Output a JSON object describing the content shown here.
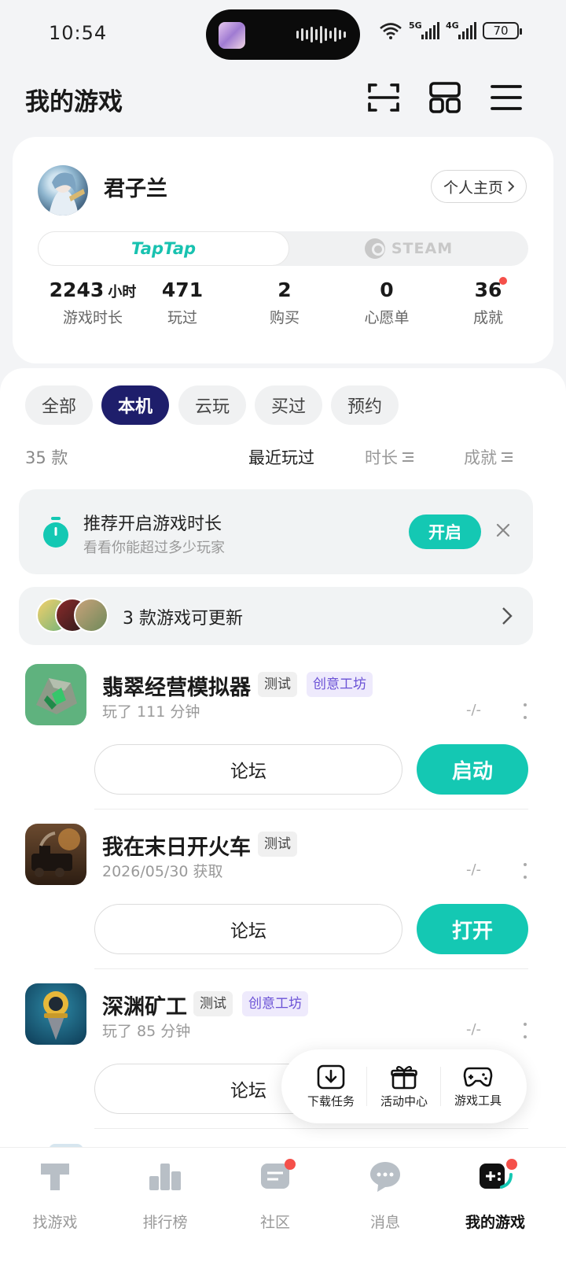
{
  "status_bar": {
    "time": "10:54",
    "net1": "5G",
    "net2": "4G",
    "battery": "70"
  },
  "header": {
    "title": "我的游戏"
  },
  "profile": {
    "username": "君子兰",
    "homepage_label": "个人主页",
    "platform_taptap": "TapTap",
    "platform_steam": "STEAM",
    "stats": [
      {
        "value": "2243",
        "unit": "小时",
        "label": "游戏时长"
      },
      {
        "value": "471",
        "unit": "",
        "label": "玩过"
      },
      {
        "value": "2",
        "unit": "",
        "label": "购买"
      },
      {
        "value": "0",
        "unit": "",
        "label": "心愿单"
      },
      {
        "value": "36",
        "unit": "",
        "label": "成就"
      }
    ]
  },
  "filters": [
    "全部",
    "本机",
    "云玩",
    "买过",
    "预约"
  ],
  "active_filter": "本机",
  "count_label": "35 款",
  "sort": [
    "最近玩过",
    "时长",
    "成就"
  ],
  "timer_banner": {
    "title": "推荐开启游戏时长",
    "subtitle": "看看你能超过多少玩家",
    "button": "开启"
  },
  "update_bar": {
    "text": "3 款游戏可更新"
  },
  "games": [
    {
      "title": "翡翠经营模拟器",
      "tags": [
        "测试",
        "创意工坊"
      ],
      "subtitle": "玩了 111 分钟",
      "ratio": "-/-",
      "forum": "论坛",
      "action": "启动"
    },
    {
      "title": "我在末日开火车",
      "tags": [
        "测试"
      ],
      "subtitle": "2026/05/30 获取",
      "ratio": "-/-",
      "forum": "论坛",
      "action": "打开"
    },
    {
      "title": "深渊矿工",
      "tags": [
        "测试",
        "创意工坊"
      ],
      "subtitle": "玩了 85 分钟",
      "ratio": "-/-",
      "forum": "论坛",
      "action": ""
    }
  ],
  "floating_toolbar": [
    "下载任务",
    "活动中心",
    "游戏工具"
  ],
  "tabs": [
    "找游戏",
    "排行榜",
    "社区",
    "消息",
    "我的游戏"
  ],
  "colors": {
    "accent": "#14c8b3",
    "active_chip": "#1e1e6b",
    "badge": "#f5504a",
    "tag_purple": "#6b52d6"
  }
}
